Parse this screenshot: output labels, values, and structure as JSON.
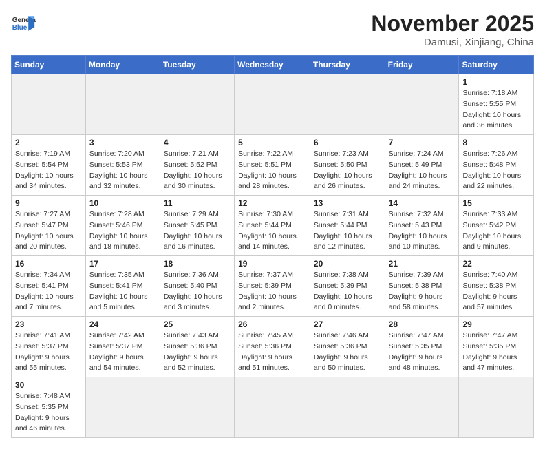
{
  "header": {
    "logo_general": "General",
    "logo_blue": "Blue",
    "month_title": "November 2025",
    "location": "Damusi, Xinjiang, China"
  },
  "days_of_week": [
    "Sunday",
    "Monday",
    "Tuesday",
    "Wednesday",
    "Thursday",
    "Friday",
    "Saturday"
  ],
  "weeks": [
    [
      {
        "day": "",
        "info": ""
      },
      {
        "day": "",
        "info": ""
      },
      {
        "day": "",
        "info": ""
      },
      {
        "day": "",
        "info": ""
      },
      {
        "day": "",
        "info": ""
      },
      {
        "day": "",
        "info": ""
      },
      {
        "day": "1",
        "info": "Sunrise: 7:18 AM\nSunset: 5:55 PM\nDaylight: 10 hours and 36 minutes."
      }
    ],
    [
      {
        "day": "2",
        "info": "Sunrise: 7:19 AM\nSunset: 5:54 PM\nDaylight: 10 hours and 34 minutes."
      },
      {
        "day": "3",
        "info": "Sunrise: 7:20 AM\nSunset: 5:53 PM\nDaylight: 10 hours and 32 minutes."
      },
      {
        "day": "4",
        "info": "Sunrise: 7:21 AM\nSunset: 5:52 PM\nDaylight: 10 hours and 30 minutes."
      },
      {
        "day": "5",
        "info": "Sunrise: 7:22 AM\nSunset: 5:51 PM\nDaylight: 10 hours and 28 minutes."
      },
      {
        "day": "6",
        "info": "Sunrise: 7:23 AM\nSunset: 5:50 PM\nDaylight: 10 hours and 26 minutes."
      },
      {
        "day": "7",
        "info": "Sunrise: 7:24 AM\nSunset: 5:49 PM\nDaylight: 10 hours and 24 minutes."
      },
      {
        "day": "8",
        "info": "Sunrise: 7:26 AM\nSunset: 5:48 PM\nDaylight: 10 hours and 22 minutes."
      }
    ],
    [
      {
        "day": "9",
        "info": "Sunrise: 7:27 AM\nSunset: 5:47 PM\nDaylight: 10 hours and 20 minutes."
      },
      {
        "day": "10",
        "info": "Sunrise: 7:28 AM\nSunset: 5:46 PM\nDaylight: 10 hours and 18 minutes."
      },
      {
        "day": "11",
        "info": "Sunrise: 7:29 AM\nSunset: 5:45 PM\nDaylight: 10 hours and 16 minutes."
      },
      {
        "day": "12",
        "info": "Sunrise: 7:30 AM\nSunset: 5:44 PM\nDaylight: 10 hours and 14 minutes."
      },
      {
        "day": "13",
        "info": "Sunrise: 7:31 AM\nSunset: 5:44 PM\nDaylight: 10 hours and 12 minutes."
      },
      {
        "day": "14",
        "info": "Sunrise: 7:32 AM\nSunset: 5:43 PM\nDaylight: 10 hours and 10 minutes."
      },
      {
        "day": "15",
        "info": "Sunrise: 7:33 AM\nSunset: 5:42 PM\nDaylight: 10 hours and 9 minutes."
      }
    ],
    [
      {
        "day": "16",
        "info": "Sunrise: 7:34 AM\nSunset: 5:41 PM\nDaylight: 10 hours and 7 minutes."
      },
      {
        "day": "17",
        "info": "Sunrise: 7:35 AM\nSunset: 5:41 PM\nDaylight: 10 hours and 5 minutes."
      },
      {
        "day": "18",
        "info": "Sunrise: 7:36 AM\nSunset: 5:40 PM\nDaylight: 10 hours and 3 minutes."
      },
      {
        "day": "19",
        "info": "Sunrise: 7:37 AM\nSunset: 5:39 PM\nDaylight: 10 hours and 2 minutes."
      },
      {
        "day": "20",
        "info": "Sunrise: 7:38 AM\nSunset: 5:39 PM\nDaylight: 10 hours and 0 minutes."
      },
      {
        "day": "21",
        "info": "Sunrise: 7:39 AM\nSunset: 5:38 PM\nDaylight: 9 hours and 58 minutes."
      },
      {
        "day": "22",
        "info": "Sunrise: 7:40 AM\nSunset: 5:38 PM\nDaylight: 9 hours and 57 minutes."
      }
    ],
    [
      {
        "day": "23",
        "info": "Sunrise: 7:41 AM\nSunset: 5:37 PM\nDaylight: 9 hours and 55 minutes."
      },
      {
        "day": "24",
        "info": "Sunrise: 7:42 AM\nSunset: 5:37 PM\nDaylight: 9 hours and 54 minutes."
      },
      {
        "day": "25",
        "info": "Sunrise: 7:43 AM\nSunset: 5:36 PM\nDaylight: 9 hours and 52 minutes."
      },
      {
        "day": "26",
        "info": "Sunrise: 7:45 AM\nSunset: 5:36 PM\nDaylight: 9 hours and 51 minutes."
      },
      {
        "day": "27",
        "info": "Sunrise: 7:46 AM\nSunset: 5:36 PM\nDaylight: 9 hours and 50 minutes."
      },
      {
        "day": "28",
        "info": "Sunrise: 7:47 AM\nSunset: 5:35 PM\nDaylight: 9 hours and 48 minutes."
      },
      {
        "day": "29",
        "info": "Sunrise: 7:47 AM\nSunset: 5:35 PM\nDaylight: 9 hours and 47 minutes."
      }
    ],
    [
      {
        "day": "30",
        "info": "Sunrise: 7:48 AM\nSunset: 5:35 PM\nDaylight: 9 hours and 46 minutes."
      },
      {
        "day": "",
        "info": ""
      },
      {
        "day": "",
        "info": ""
      },
      {
        "day": "",
        "info": ""
      },
      {
        "day": "",
        "info": ""
      },
      {
        "day": "",
        "info": ""
      },
      {
        "day": "",
        "info": ""
      }
    ]
  ]
}
